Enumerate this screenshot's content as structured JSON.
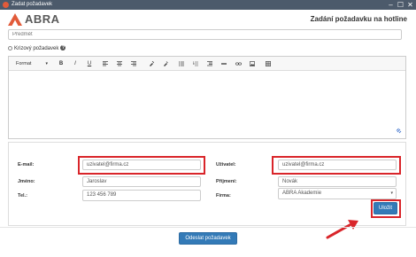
{
  "window": {
    "title": "Zadat požadavek",
    "controls": {
      "minimize": "–",
      "maximize": "☐",
      "close": "✕"
    }
  },
  "brand": {
    "name": "ABRA"
  },
  "page": {
    "title": "Zadání požadavku na hotline"
  },
  "subject": {
    "placeholder": "Předmět"
  },
  "crisis": {
    "label": "Krizový požadavek",
    "help": "?"
  },
  "editor": {
    "format_label": "Format",
    "format_caret": "▾",
    "toolbar": {
      "bold": "B",
      "italic": "I",
      "underline": "U"
    }
  },
  "form": {
    "email_label": "E-mail:",
    "email_value": "uzivatel@firma.cz",
    "user_label": "Uživatel:",
    "user_value": "uzivatel@firma.cz",
    "firstname_label": "Jméno:",
    "firstname_value": "Jaroslav",
    "surname_label": "Příjmení:",
    "surname_value": "Novák",
    "phone_label": "Tel.:",
    "phone_value": "123 456 789",
    "company_label": "Firma:",
    "company_value": "ABRA Akademie",
    "company_caret": "▾",
    "save_label": "Uložit"
  },
  "submit": {
    "label": "Odeslat požadavek"
  },
  "colors": {
    "accent": "#337ab7",
    "highlight": "#d9252a",
    "titlebar": "#4c5a6b",
    "logo": "#e25b3a"
  },
  "icons": {
    "app": "abra-app-icon",
    "help": "question-circle-icon",
    "resize": "resize-grip-icon",
    "annotation": "red-arrow-icon"
  }
}
